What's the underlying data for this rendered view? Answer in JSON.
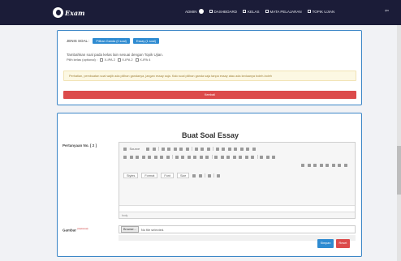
{
  "app": {
    "logo_text": "Exam"
  },
  "nav": {
    "user": "ADMIN",
    "items": [
      {
        "label": "DASHBOARD",
        "icon": "home-icon"
      },
      {
        "label": "KELAS",
        "icon": "grid-icon"
      },
      {
        "label": "MATA PELAJARAN",
        "icon": "book-icon"
      },
      {
        "label": "TOPIK UJIAN",
        "icon": "chart-icon"
      }
    ],
    "logout_icon": "logout-icon"
  },
  "jenis_soal": {
    "label": "JENIS SOAL :",
    "btn_pilihan_ganda": "Pilihan Ganda (0 soal)",
    "btn_essay": "Essay (1 soal)",
    "note": "Tambahkan soal pada kelas lain sesuai dengan Topik Ujian.",
    "kelas_label": "Pilih kelas (optional) :",
    "kelas_options": [
      "X-IPA 2",
      "X-IPA 2",
      "X-IPA 4"
    ],
    "warning": "Perhatian, pembuatan soal wajib ada pilihan gandanya, jangan essay saja. Kalo soal pilihan ganda saja tanpa essay atau ada keduanya boleh-boleh",
    "btn_kembali": "Kembali"
  },
  "form": {
    "title": "Buat Soal Essay",
    "pertanyaan_label": "Pertanyaan No. [ 2 ]",
    "toolbar": {
      "source": "Source",
      "styles": "Styles",
      "format": "Format",
      "font": "Font",
      "size": "Size"
    },
    "editor_path": "body",
    "gambar_label": "Gambar",
    "gambar_optional": "(Optional)",
    "browse": "Browse...",
    "no_file": "No file selected.",
    "btn_simpan": "Simpan",
    "btn_reset": "Reset"
  },
  "colors": {
    "nav_bg": "#1b1c38",
    "primary": "#2e8bd1",
    "danger": "#dc4b4b",
    "warning_bg": "#fcf8e3"
  }
}
